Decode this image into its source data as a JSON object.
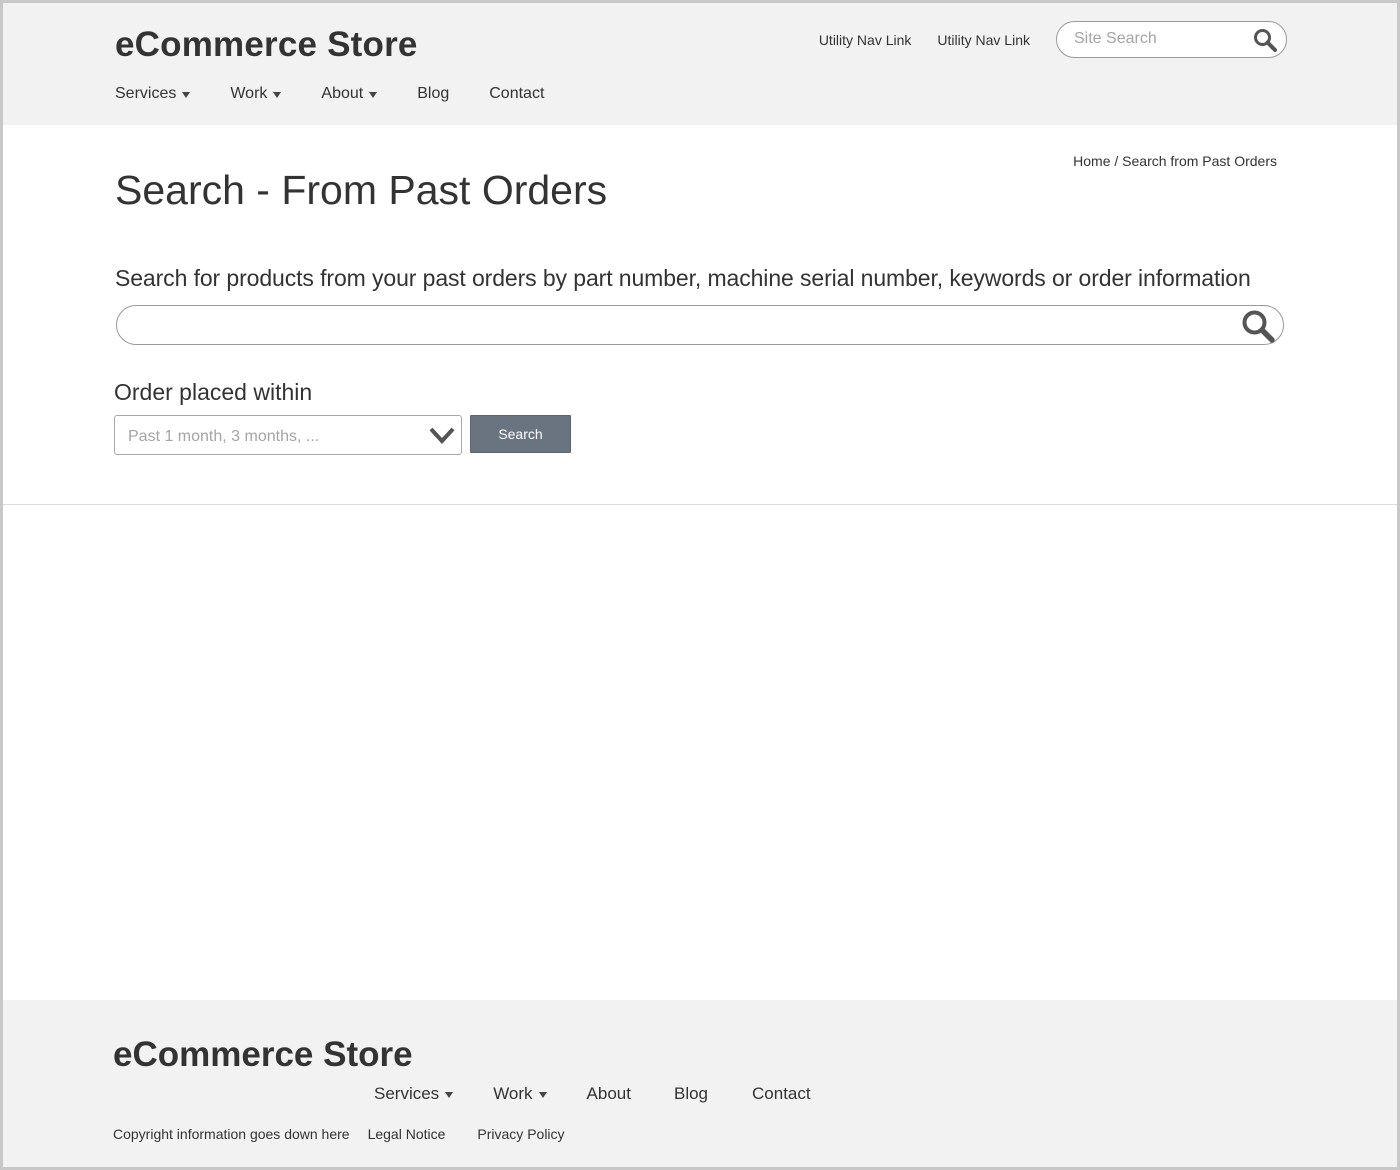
{
  "header": {
    "brand": "eCommerce Store",
    "utility_links": [
      "Utility Nav Link",
      "Utility Nav Link"
    ],
    "site_search": {
      "placeholder": "Site Search",
      "icon": "search-icon"
    },
    "nav": [
      {
        "label": "Services",
        "has_dropdown": true
      },
      {
        "label": "Work",
        "has_dropdown": true
      },
      {
        "label": "About",
        "has_dropdown": true
      },
      {
        "label": "Blog",
        "has_dropdown": false
      },
      {
        "label": "Contact",
        "has_dropdown": false
      }
    ]
  },
  "breadcrumb": {
    "home": "Home",
    "separator": " / ",
    "current": "Search from Past Orders"
  },
  "main": {
    "title": "Search - From Past Orders",
    "instructions": "Search for products from your past orders by part number, machine serial number, keywords or order information",
    "search_value": "",
    "filter": {
      "label": "Order placed within",
      "placeholder": "Past 1 month, 3 months, ..."
    },
    "submit_label": "Search"
  },
  "footer": {
    "brand": "eCommerce Store",
    "nav": [
      {
        "label": "Services",
        "has_dropdown": true
      },
      {
        "label": "Work",
        "has_dropdown": true
      },
      {
        "label": "About",
        "has_dropdown": false
      },
      {
        "label": "Blog",
        "has_dropdown": false
      },
      {
        "label": "Contact",
        "has_dropdown": false
      }
    ],
    "copyright": "Copyright information goes down here",
    "legal_links": [
      "Legal Notice",
      "Privacy Policy"
    ]
  },
  "colors": {
    "header_bg": "#f2f2f2",
    "text": "#333333",
    "button_bg": "#6a7480",
    "placeholder": "#a5a5a5"
  }
}
